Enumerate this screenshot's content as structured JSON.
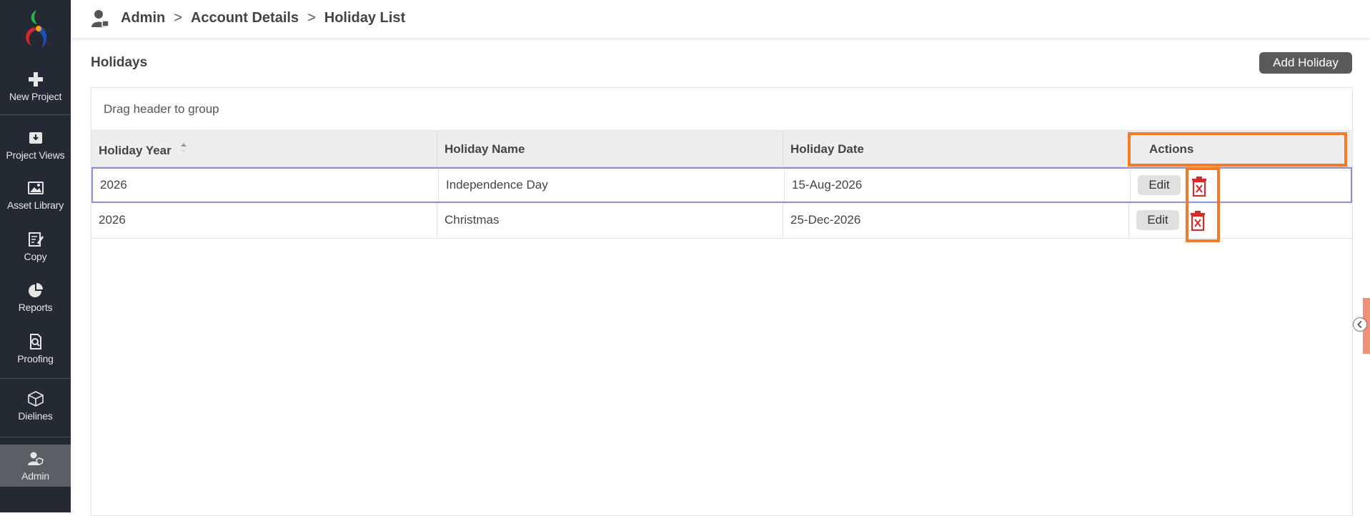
{
  "sidebar": {
    "items": [
      {
        "label": "New Project",
        "icon": "plus-icon"
      },
      {
        "label": "Project Views",
        "icon": "inbox-icon"
      },
      {
        "label": "Asset Library",
        "icon": "image-icon"
      },
      {
        "label": "Copy",
        "icon": "edit-document-icon"
      },
      {
        "label": "Reports",
        "icon": "pie-chart-icon"
      },
      {
        "label": "Proofing",
        "icon": "search-document-icon"
      },
      {
        "label": "Dielines",
        "icon": "box-icon"
      },
      {
        "label": "Admin",
        "icon": "admin-user-icon"
      }
    ]
  },
  "breadcrumb": {
    "items": [
      "Admin",
      "Account Details",
      "Holiday List"
    ],
    "separator": ">"
  },
  "page": {
    "title": "Holidays",
    "add_button": "Add Holiday"
  },
  "grid": {
    "group_panel": "Drag header to group",
    "columns": [
      "Holiday Year",
      "Holiday Name",
      "Holiday Date",
      "Actions"
    ],
    "rows": [
      {
        "year": "2026",
        "name": "Independence Day",
        "date": "15-Aug-2026"
      },
      {
        "year": "2026",
        "name": "Christmas",
        "date": "25-Dec-2026"
      }
    ],
    "edit_label": "Edit"
  },
  "colors": {
    "sidebar_bg": "#232a33",
    "highlight": "#f47a2a",
    "delete_red": "#d62b2b",
    "selected_row_border": "#8a8fd6"
  }
}
